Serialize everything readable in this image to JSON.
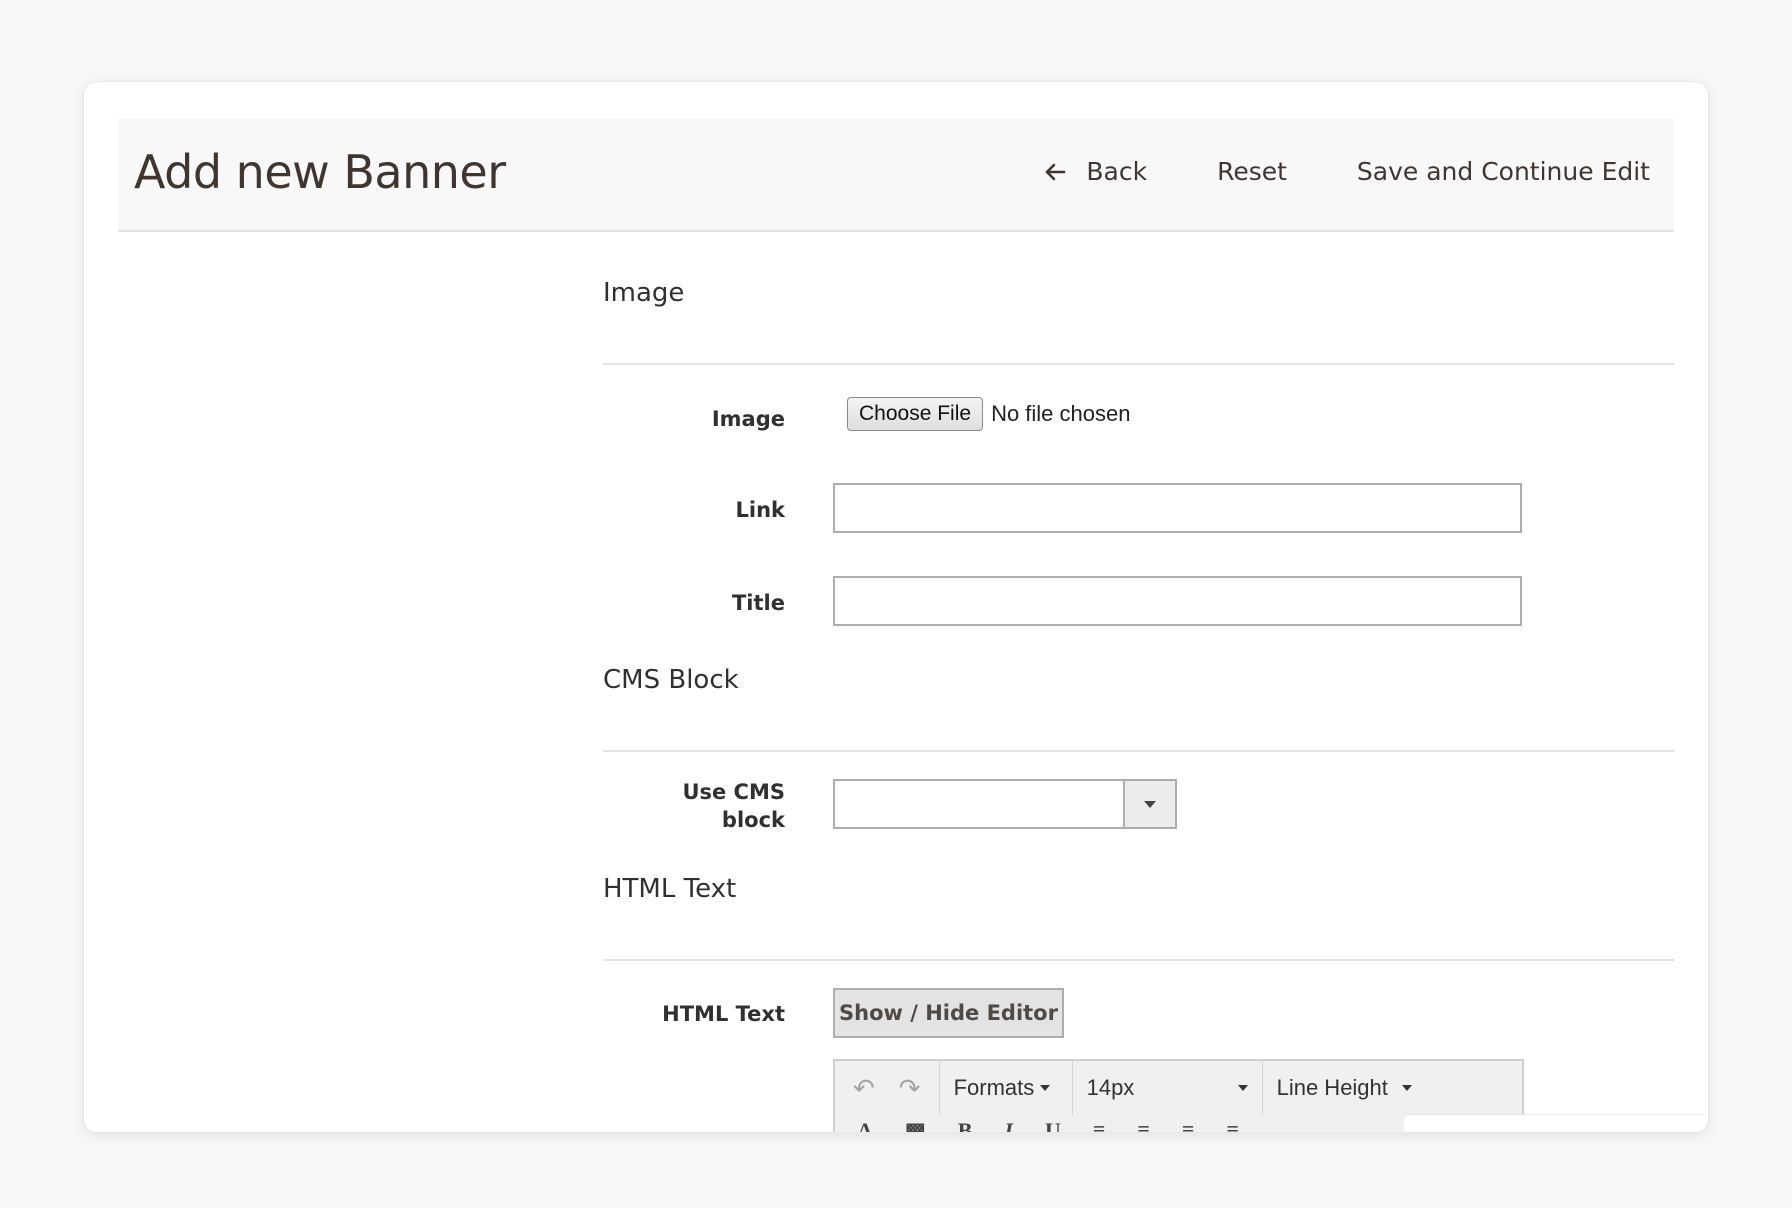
{
  "header": {
    "title": "Add new Banner",
    "back_label": "Back",
    "reset_label": "Reset",
    "save_continue_label": "Save and Continue Edit"
  },
  "sections": {
    "image": {
      "title": "Image",
      "image_label": "Image",
      "choose_file_label": "Choose File",
      "file_status": "No file chosen",
      "link_label": "Link",
      "link_value": "",
      "title_label": "Title",
      "title_value": ""
    },
    "cms_block": {
      "title": "CMS Block",
      "use_cms_label_line1": "Use CMS",
      "use_cms_label_line2": "block",
      "selected_value": ""
    },
    "html_text": {
      "title": "HTML Text",
      "field_label": "HTML Text",
      "toggle_editor_label": "Show / Hide Editor"
    }
  },
  "editor_toolbar": {
    "formats_label": "Formats",
    "font_size_value": "14px",
    "line_height_label": "Line Height",
    "undo_icon": "undo-icon",
    "redo_icon": "redo-icon"
  },
  "colors": {
    "background": "#f7f7f7",
    "header_bg": "#f8f8f8",
    "title_text": "#41362f",
    "button_bg": "#e3e3e3"
  }
}
